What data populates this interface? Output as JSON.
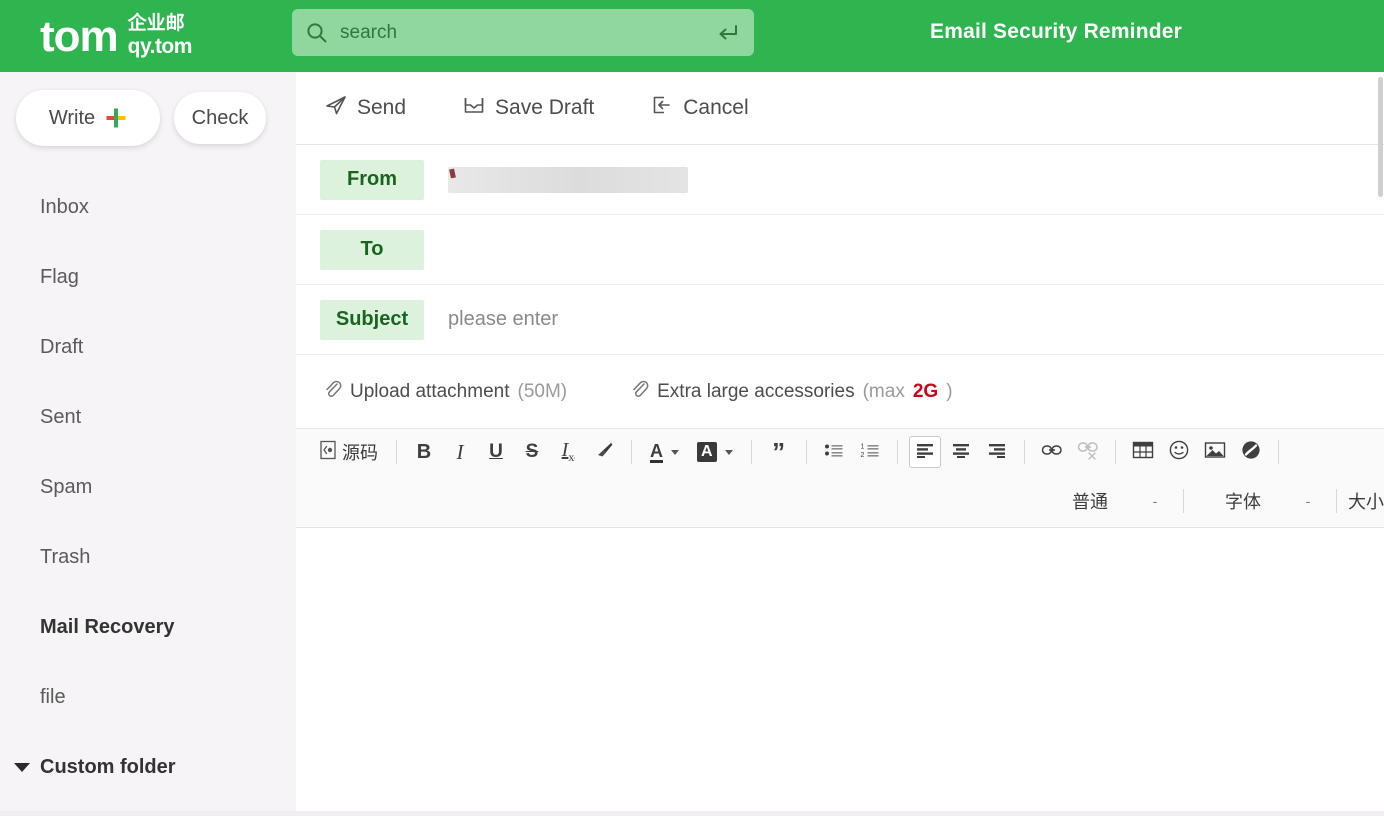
{
  "header": {
    "logo_main": "tom",
    "logo_cn_top": "企业邮",
    "logo_cn_bottom": "qy.tom",
    "title": "Email Security Reminder",
    "brand_color": "#2fb550",
    "search": {
      "placeholder": "search",
      "value": "",
      "icon": "search-icon",
      "enter_icon": "enter-return-icon"
    }
  },
  "sidebar": {
    "write_button": "Write",
    "check_button": "Check",
    "plus_icon": "plus-icon",
    "items": [
      {
        "label": "Inbox",
        "bold": false
      },
      {
        "label": "Flag",
        "bold": false
      },
      {
        "label": "Draft",
        "bold": false
      },
      {
        "label": "Sent",
        "bold": false
      },
      {
        "label": "Spam",
        "bold": false
      },
      {
        "label": "Trash",
        "bold": false
      },
      {
        "label": "Mail Recovery",
        "bold": true
      },
      {
        "label": "file",
        "bold": false
      }
    ],
    "custom_folder": "Custom folder"
  },
  "actions": {
    "send": "Send",
    "save_draft": "Save Draft",
    "cancel": "Cancel"
  },
  "compose": {
    "from_label": "From",
    "from_value": "",
    "to_label": "To",
    "to_value": "",
    "subject_label": "Subject",
    "subject_placeholder": "please enter",
    "subject_value": ""
  },
  "attachments": {
    "upload_label": "Upload attachment",
    "upload_limit": "(50M)",
    "large_label": "Extra large accessories",
    "large_prefix": "(max ",
    "large_limit": "2G",
    "large_suffix": ")",
    "limit_color": "#d0021b"
  },
  "editor_toolbar": {
    "source_code": "源码",
    "bold": "B",
    "italic": "I",
    "underline": "U",
    "strike": "S",
    "remove_format": "I",
    "remove_format_sub": "x",
    "eraser": "eraser-brush-icon",
    "text_color": "A",
    "highlight_color": "A",
    "quote": "”",
    "bullet_list": "bulleted-list-icon",
    "numbered_list": "numbered-list-icon",
    "align_left": "align-left-icon",
    "align_center": "align-center-icon",
    "align_right": "align-right-icon",
    "link": "link-icon",
    "unlink": "unlink-icon",
    "table": "table-icon",
    "emoji": "emoji-icon",
    "image": "image-icon",
    "signature": "signature-icon",
    "dropdowns": [
      {
        "name": "普通",
        "caret": "-"
      },
      {
        "name": "字体",
        "caret": "-"
      },
      {
        "name": "大小",
        "caret": "-"
      }
    ]
  }
}
